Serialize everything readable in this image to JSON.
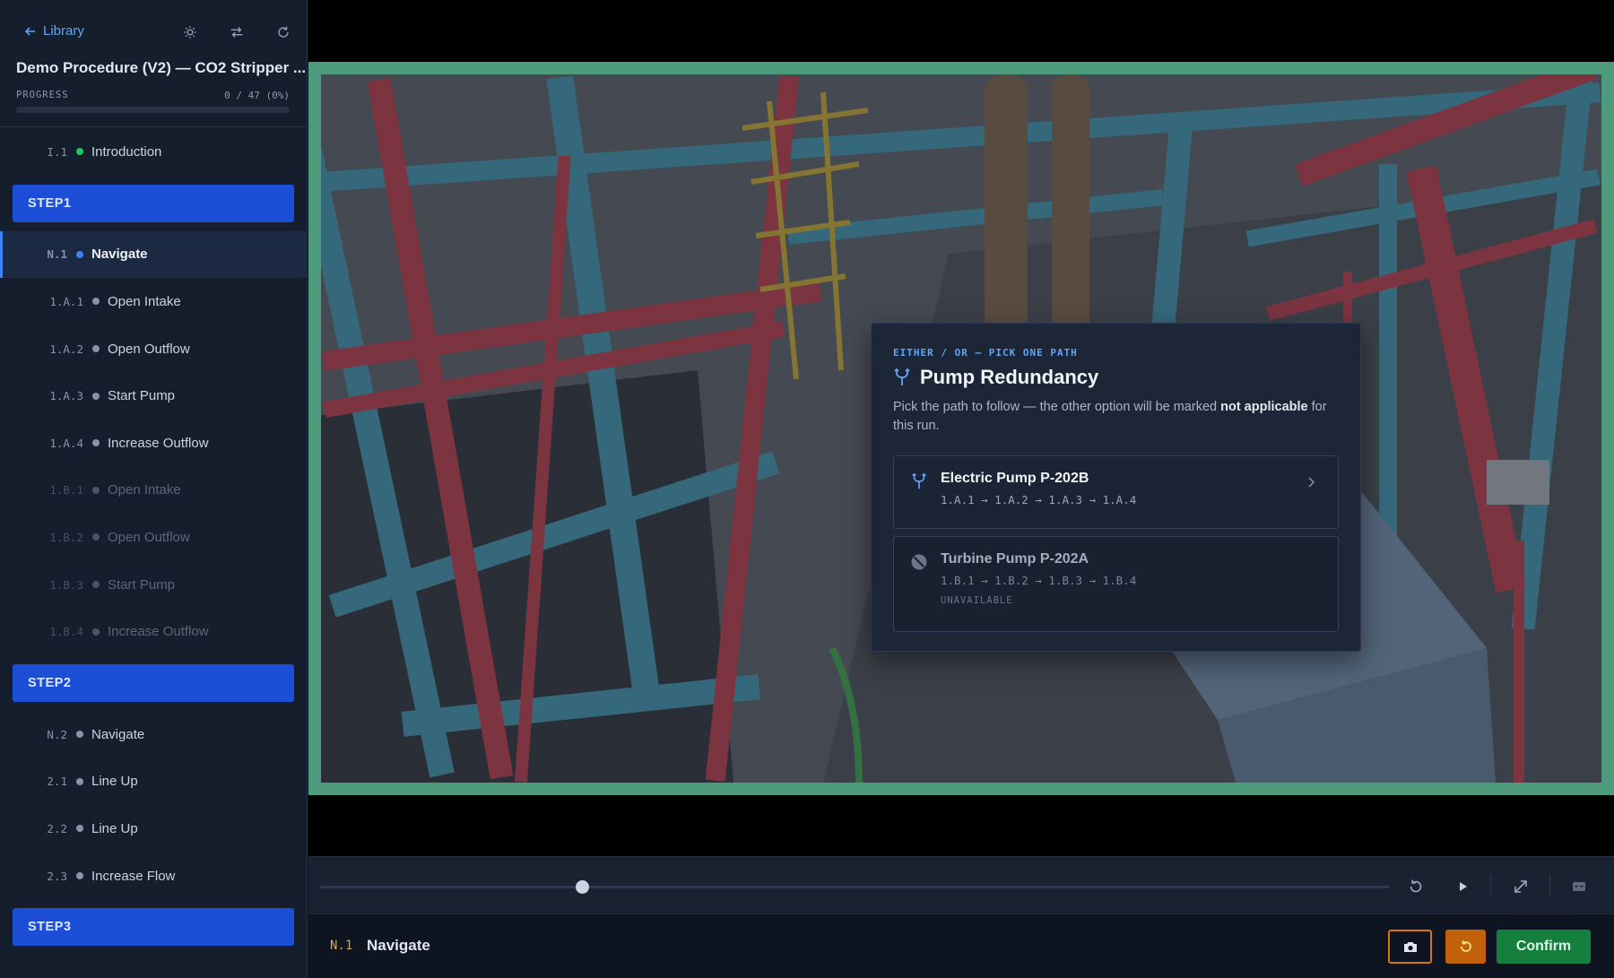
{
  "sidebar": {
    "back_label": "Library",
    "title": "Demo Procedure (V2) — CO2 Stripper ...",
    "progress_label": "PROGRESS",
    "progress_count": "0 / 47 (0%)",
    "progress_fraction": 0,
    "intro": {
      "num": "I.1",
      "label": "Introduction"
    },
    "step1": {
      "header": "STEP1",
      "items": [
        {
          "num": "N.1",
          "label": "Navigate"
        },
        {
          "num": "1.A.1",
          "label": "Open Intake"
        },
        {
          "num": "1.A.2",
          "label": "Open Outflow"
        },
        {
          "num": "1.A.3",
          "label": "Start Pump"
        },
        {
          "num": "1.A.4",
          "label": "Increase Outflow"
        },
        {
          "num": "1.B.1",
          "label": "Open Intake"
        },
        {
          "num": "1.B.2",
          "label": "Open Outflow"
        },
        {
          "num": "1.B.3",
          "label": "Start Pump"
        },
        {
          "num": "1.B.4",
          "label": "Increase Outflow"
        }
      ]
    },
    "step2": {
      "header": "STEP2",
      "items": [
        {
          "num": "N.2",
          "label": "Navigate"
        },
        {
          "num": "2.1",
          "label": "Line Up"
        },
        {
          "num": "2.2",
          "label": "Line Up"
        },
        {
          "num": "2.3",
          "label": "Increase Flow"
        }
      ]
    },
    "step3": {
      "header": "STEP3"
    }
  },
  "modal": {
    "kicker": "EITHER / OR — PICK ONE PATH",
    "title": "Pump Redundancy",
    "desc_pre": "Pick the path to follow — the other option will be marked ",
    "desc_bold": "not applicable",
    "desc_post": " for this run.",
    "options": [
      {
        "title": "Electric Pump P-202B",
        "path": "1.A.1 → 1.A.2 → 1.A.3 → 1.A.4",
        "icon": "fork-icon"
      },
      {
        "title": "Turbine Pump P-202A",
        "path": "1.B.1 → 1.B.2 → 1.B.3 → 1.B.4",
        "status": "UNAVAILABLE",
        "icon": "blocked-icon"
      }
    ]
  },
  "player": {
    "scrub_fraction": 0.245
  },
  "footer": {
    "step_num": "N.1",
    "step_name": "Navigate",
    "confirm_label": "Confirm"
  },
  "colors": {
    "accent": "#3b82f6",
    "step_header": "#1d4ed8",
    "frame": "#4e9a7c",
    "confirm": "#15803d",
    "reset": "#c2610c"
  }
}
